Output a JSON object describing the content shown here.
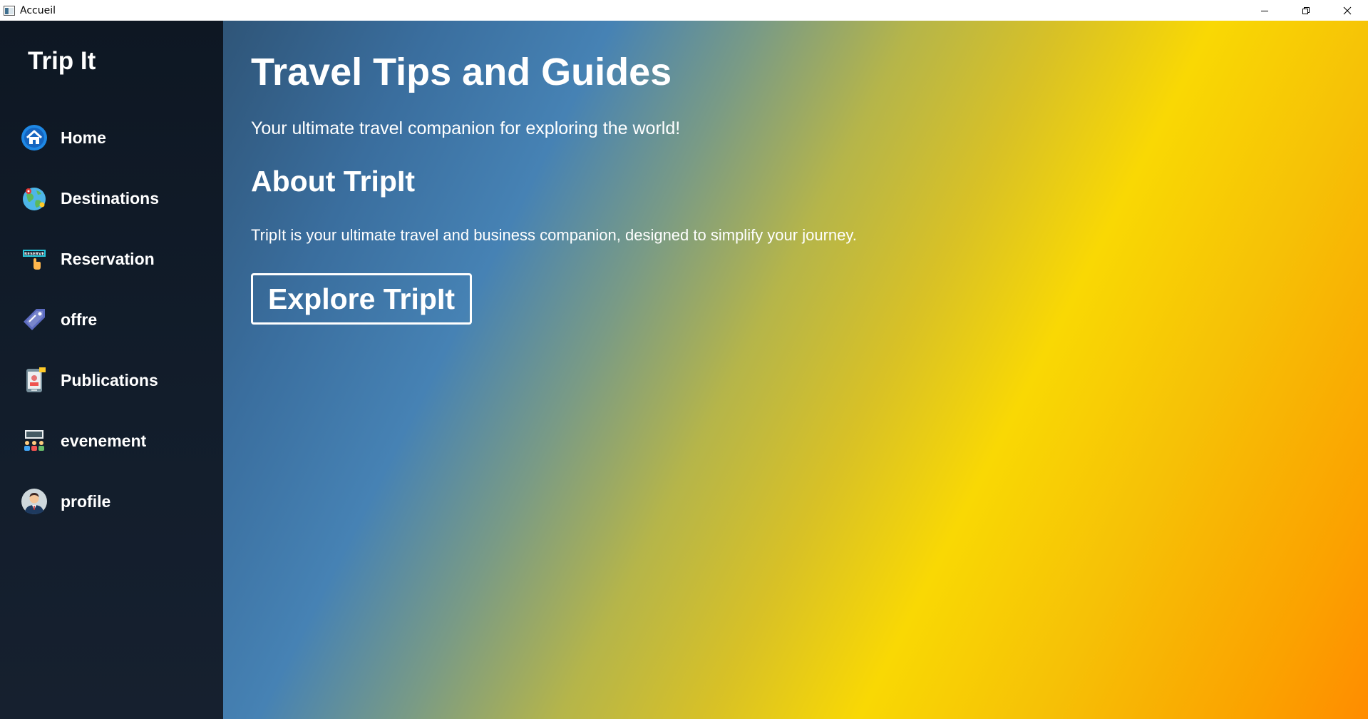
{
  "window": {
    "title": "Accueil",
    "controls": [
      "minimize",
      "restore",
      "close"
    ]
  },
  "sidebar": {
    "brand": "Trip It",
    "items": [
      {
        "label": "Home",
        "icon": "home-icon"
      },
      {
        "label": "Destinations",
        "icon": "globe-icon"
      },
      {
        "label": "Reservation",
        "icon": "reserve-sign-icon"
      },
      {
        "label": "offre",
        "icon": "price-tag-icon"
      },
      {
        "label": "Publications",
        "icon": "phone-post-icon"
      },
      {
        "label": "evenement",
        "icon": "event-group-icon"
      },
      {
        "label": "profile",
        "icon": "user-avatar-icon"
      }
    ]
  },
  "main": {
    "heading": "Travel Tips and Guides",
    "subtitle": "Your ultimate travel companion for exploring the world!",
    "about_heading": "About TripIt",
    "about_text": "TripIt is your ultimate travel and business companion, designed to simplify your journey.",
    "cta_label": "Explore TripIt"
  },
  "colors": {
    "sidebar_bg": "#111b28",
    "gradient_start": "#2f5578",
    "gradient_blue": "#4682b4",
    "gradient_yellow": "#f9d804",
    "gradient_end": "#ff8c00",
    "text": "#ffffff"
  }
}
